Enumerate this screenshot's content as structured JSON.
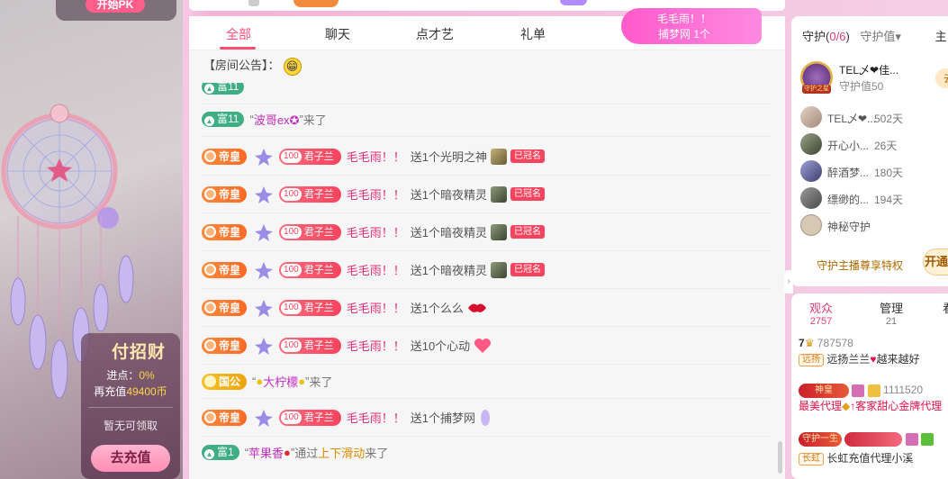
{
  "stream": {
    "pk_label": "开始PK",
    "promo": {
      "title": "付招财",
      "progress_label": "进点：",
      "progress_value": "0%",
      "recharge_prefix": "再充值",
      "recharge_amount": "49400币",
      "unavailable": "暂无可领取",
      "recharge_button": "去充值"
    }
  },
  "chat": {
    "tabs": [
      "全部",
      "聊天",
      "点才艺",
      "礼单"
    ],
    "active_tab": "全部",
    "announcement_label": "【房间公告】：",
    "notice": {
      "line1": "毛毛雨！！",
      "line2": "捕梦网 1个"
    },
    "messages": [
      {
        "type": "enter",
        "rich_level": "富11",
        "name": "波哥ex✪",
        "suffix": "来了"
      },
      {
        "type": "gift",
        "badge": "帝皇",
        "fan_level": "100",
        "fan_name": "君子兰",
        "name": "毛毛雨！！",
        "text": "送1个光明之神",
        "crown": "已冠名"
      },
      {
        "type": "gift",
        "badge": "帝皇",
        "fan_level": "100",
        "fan_name": "君子兰",
        "name": "毛毛雨！！",
        "text": "送1个暗夜精灵",
        "crown": "已冠名"
      },
      {
        "type": "gift",
        "badge": "帝皇",
        "fan_level": "100",
        "fan_name": "君子兰",
        "name": "毛毛雨！！",
        "text": "送1个暗夜精灵",
        "crown": "已冠名"
      },
      {
        "type": "gift",
        "badge": "帝皇",
        "fan_level": "100",
        "fan_name": "君子兰",
        "name": "毛毛雨！！",
        "text": "送1个暗夜精灵",
        "crown": "已冠名"
      },
      {
        "type": "gift",
        "badge": "帝皇",
        "fan_level": "100",
        "fan_name": "君子兰",
        "name": "毛毛雨！！",
        "text": "送1个么么"
      },
      {
        "type": "gift",
        "badge": "帝皇",
        "fan_level": "100",
        "fan_name": "君子兰",
        "name": "毛毛雨！！",
        "text": "送10个心动"
      },
      {
        "type": "enter_duke",
        "badge": "国公",
        "name": "大柠檬",
        "suffix": "来了"
      },
      {
        "type": "gift",
        "badge": "帝皇",
        "fan_level": "100",
        "fan_name": "君子兰",
        "name": "毛毛雨！！",
        "text": "送1个捕梦网"
      },
      {
        "type": "enter_swipe",
        "rich_level": "富1",
        "name": "苹果香",
        "via": "通过",
        "via_link": "上下滑动",
        "suffix": "来了"
      }
    ]
  },
  "right": {
    "guard_tab": "守护",
    "guard_count": "0/6",
    "guard_value_tab": "守护值▾",
    "third_tab": "主",
    "top_guard": {
      "name": "TEL乄❤佳...",
      "value": "守护值50",
      "frame_label": "守护之星",
      "go_label": "去"
    },
    "guards": [
      {
        "name": "TEL乄❤...",
        "days": "502天"
      },
      {
        "name": "开心小...",
        "days": "26天"
      },
      {
        "name": "醉酒梦...",
        "days": "180天"
      },
      {
        "name": "缥缈的...",
        "days": "194天"
      },
      {
        "name": "神秘守护",
        "days": ""
      }
    ],
    "privilege_label": "守护主播尊享特权",
    "open_label": "开通",
    "viewer_tabs": [
      {
        "label": "观众",
        "count": "2757"
      },
      {
        "label": "管理",
        "count": "21"
      },
      {
        "label": "看",
        "count": ""
      }
    ],
    "viewers": [
      {
        "level": "7",
        "id": "787578",
        "tag": "远扬",
        "name": "远扬兰兰",
        "motto": "越来越好"
      },
      {
        "badge": "神皇",
        "id": "1111520",
        "name": "最美代理",
        "motto": "↑客家甜心金牌代理"
      },
      {
        "badge": "守护一生",
        "tag": "长虹",
        "name": "长虹充值代理小溪"
      }
    ]
  }
}
